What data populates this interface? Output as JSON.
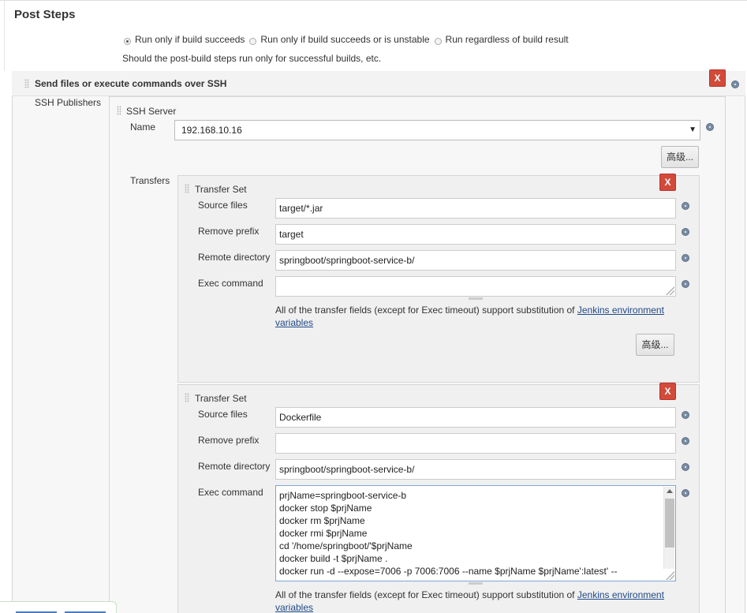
{
  "header": {
    "title": "Post Steps"
  },
  "run_conditions": {
    "options": [
      {
        "label": "Run only if build succeeds",
        "selected": true
      },
      {
        "label": "Run only if build succeeds or is unstable",
        "selected": false
      },
      {
        "label": "Run regardless of build result",
        "selected": false
      }
    ],
    "description": "Should the post-build steps run only for successful builds, etc."
  },
  "ssh_section": {
    "title": "Send files or execute commands over SSH",
    "delete_label": "X",
    "publishers_label": "SSH Publishers",
    "server": {
      "title": "SSH Server",
      "name_label": "Name",
      "name_value": "192.168.10.16",
      "advanced_label": "高级..."
    },
    "transfers_label": "Transfers",
    "transfer_sets": [
      {
        "title": "Transfer Set",
        "delete_label": "X",
        "source_files_label": "Source files",
        "source_files": "target/*.jar",
        "remove_prefix_label": "Remove prefix",
        "remove_prefix": "target",
        "remote_directory_label": "Remote directory",
        "remote_directory": "springboot/springboot-service-b/",
        "exec_command_label": "Exec command",
        "exec_command": "",
        "note_text": "All of the transfer fields (except for Exec timeout) support substitution of ",
        "note_link": "Jenkins environment variables",
        "advanced_label": "高级..."
      },
      {
        "title": "Transfer Set",
        "delete_label": "X",
        "source_files_label": "Source files",
        "source_files": "Dockerfile",
        "remove_prefix_label": "Remove prefix",
        "remove_prefix": "",
        "remote_directory_label": "Remote directory",
        "remote_directory": "springboot/springboot-service-b/",
        "exec_command_label": "Exec command",
        "exec_command_lines": [
          "prjName=springboot-service-b",
          "docker stop $prjName",
          "docker rm $prjName",
          "docker rmi $prjName",
          "cd '/home/springboot/'$prjName",
          "docker build -t $prjName .",
          "docker run -d --expose=7006 -p 7006:7006 --name $prjName $prjName':latest' --"
        ],
        "note_text": "All of the transfer fields (except for Exec timeout) support substitution of ",
        "note_link": "Jenkins environment variables"
      }
    ]
  },
  "colors": {
    "delete_red": "#d24a39",
    "link_blue": "#204a87",
    "help_icon": "#7a8ca3"
  }
}
